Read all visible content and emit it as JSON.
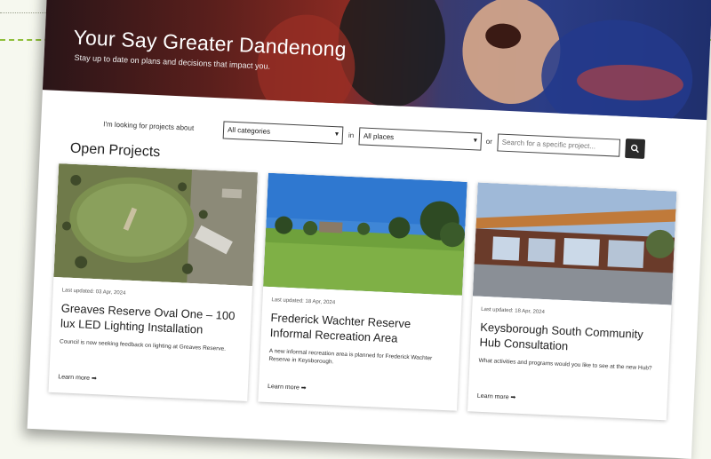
{
  "hero": {
    "title": "Your Say Greater Dandenong",
    "subtitle": "Stay up to date on plans and decisions that impact you."
  },
  "filter": {
    "label": "I'm looking for projects about",
    "category_value": "All categories",
    "in_label": "in",
    "place_value": "All places",
    "or_label": "or",
    "search_placeholder": "Search for a specific project..."
  },
  "section_title": "Open Projects",
  "projects": [
    {
      "updated": "Last updated: 03 Apr, 2024",
      "title": "Greaves Reserve Oval One – 100 lux LED Lighting Installation",
      "description": "Council is now seeking feedback on lighting at Greaves Reserve.",
      "link": "Learn more ➡"
    },
    {
      "updated": "Last updated: 18 Apr, 2024",
      "title": "Frederick Wachter Reserve Informal Recreation Area",
      "description": "A new informal recreation area is planned for Frederick Wachter Reserve in Keysborough.",
      "link": "Learn more ➡"
    },
    {
      "updated": "Last updated: 18 Apr, 2024",
      "title": "Keysborough South Community Hub Consultation",
      "description": "What activities and programs would you like to see at the new Hub?",
      "link": "Learn more ➡"
    }
  ],
  "colors": {
    "page_background": "#f6f8ef",
    "accent_dash": "#8fbf3a",
    "search_button": "#2a2a2a"
  }
}
